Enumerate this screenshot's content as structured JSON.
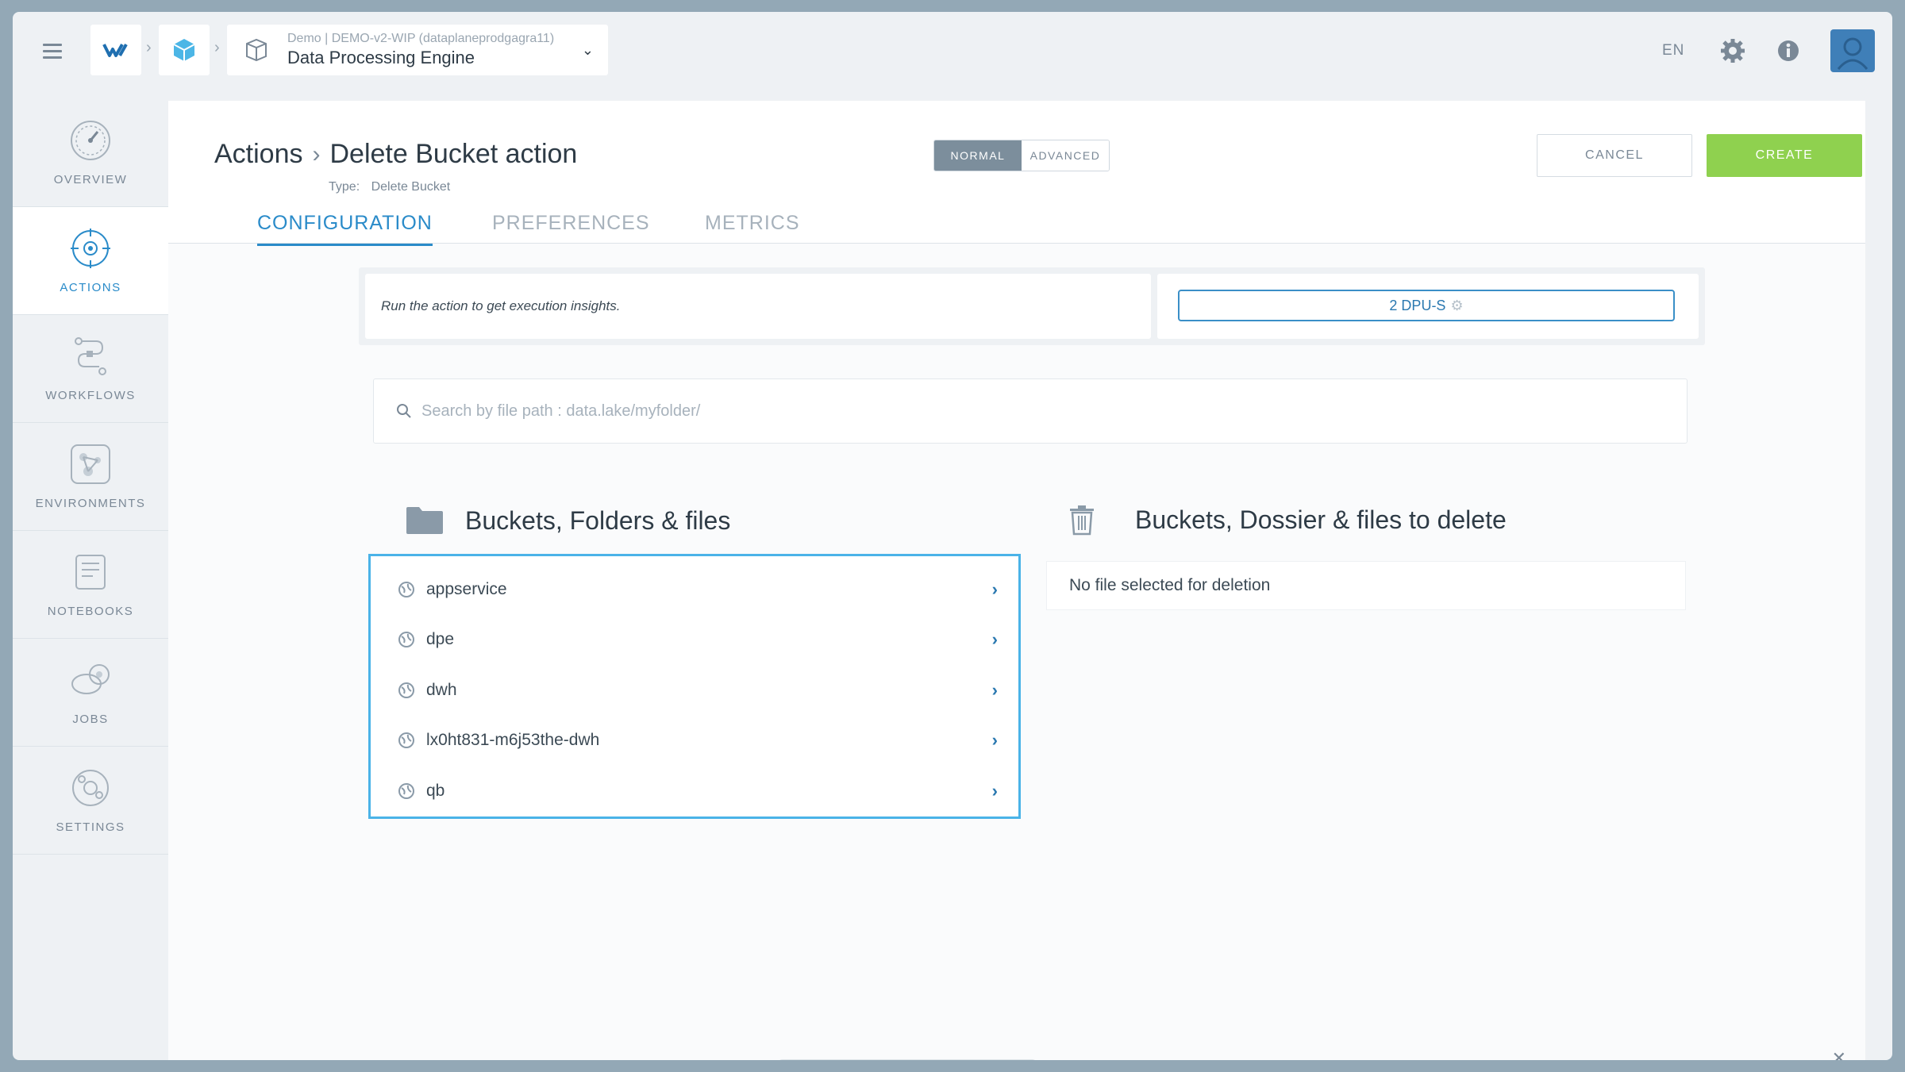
{
  "topbar": {
    "project_sub": "Demo | DEMO-v2-WIP (dataplaneprodgagra11)",
    "project_title": "Data Processing Engine",
    "language": "EN",
    "caret": "⌄"
  },
  "sidebar": {
    "items": [
      {
        "label": "OVERVIEW",
        "icon": "overview-icon"
      },
      {
        "label": "ACTIONS",
        "icon": "actions-icon",
        "active": true
      },
      {
        "label": "WORKFLOWS",
        "icon": "workflows-icon"
      },
      {
        "label": "ENVIRONMENTS",
        "icon": "environments-icon"
      },
      {
        "label": "NOTEBOOKS",
        "icon": "notebooks-icon"
      },
      {
        "label": "JOBS",
        "icon": "jobs-icon"
      },
      {
        "label": "SETTINGS",
        "icon": "settings-icon"
      }
    ]
  },
  "header": {
    "crumb_parent": "Actions",
    "crumb_current": "Delete Bucket action",
    "type_label": "Type:",
    "type_value": "Delete Bucket",
    "mode_normal": "NORMAL",
    "mode_advanced": "ADVANCED",
    "cancel_label": "CANCEL",
    "create_label": "CREATE"
  },
  "tabs": {
    "configuration": "CONFIGURATION",
    "preferences": "PREFERENCES",
    "metrics": "METRICS"
  },
  "insights": {
    "text": "Run the action to get execution insights.",
    "dpu_label": "2 DPU-S"
  },
  "search": {
    "placeholder": "Search by file path : data.lake/myfolder/"
  },
  "source": {
    "title": "Buckets, Folders & files",
    "items": [
      "appservice",
      "dpe",
      "dwh",
      "lx0ht831-m6j53the-dwh",
      "qb"
    ]
  },
  "target": {
    "title": "Buckets, Dossier & files to delete",
    "empty_text": "No file selected for deletion"
  },
  "colors": {
    "accent": "#2a8bc9",
    "create": "#8fd14f",
    "list_border": "#4ab3e8"
  }
}
